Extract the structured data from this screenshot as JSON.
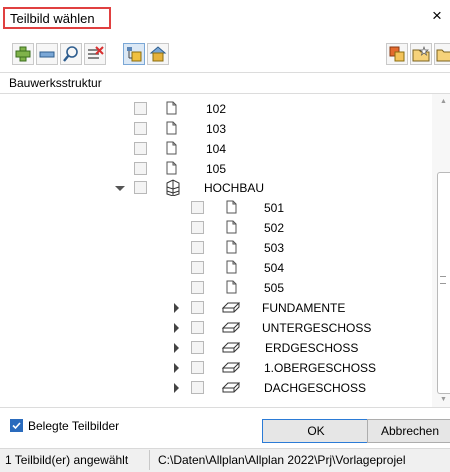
{
  "window": {
    "title": "Teilbild wählen",
    "close_symbol": "×"
  },
  "toolbar": {
    "left_icons": [
      "add-icon",
      "remove-icon",
      "search-icon",
      "clear-selection-icon",
      "structure-view-icon",
      "house-structure-icon"
    ],
    "right_icons": [
      "copy-icon",
      "folder-star-icon",
      "export-icon"
    ]
  },
  "structure_header": "Bauwerksstruktur",
  "tree": {
    "items": [
      {
        "label": "102",
        "type": "drawing"
      },
      {
        "label": "103",
        "type": "drawing"
      },
      {
        "label": "104",
        "type": "drawing"
      },
      {
        "label": "105",
        "type": "drawing"
      },
      {
        "label": "HOCHBAU",
        "type": "building",
        "expanded": true
      },
      {
        "label": "501",
        "type": "drawing"
      },
      {
        "label": "502",
        "type": "drawing"
      },
      {
        "label": "503",
        "type": "drawing"
      },
      {
        "label": "504",
        "type": "drawing"
      },
      {
        "label": "505",
        "type": "drawing"
      },
      {
        "label": "FUNDAMENTE",
        "type": "floor",
        "expanded": false
      },
      {
        "label": "UNTERGESCHOSS",
        "type": "floor",
        "expanded": false
      },
      {
        "label": "ERDGESCHOSS",
        "type": "floor",
        "expanded": false
      },
      {
        "label": "1.OBERGESCHOSS",
        "type": "floor",
        "expanded": false
      },
      {
        "label": "DACHGESCHOSS",
        "type": "floor",
        "expanded": false
      }
    ]
  },
  "options": {
    "belegte_label": "Belegte Teilbilder",
    "belegte_checked": true
  },
  "buttons": {
    "ok": "OK",
    "cancel": "Abbrechen"
  },
  "status": {
    "selected": "1 Teilbild(er) angewählt",
    "path": "C:\\Daten\\Allplan\\Allplan 2022\\Prj\\Vorlageprojel"
  },
  "colors": {
    "accent": "#2a6bbd",
    "highlight_box": "#e04040"
  }
}
